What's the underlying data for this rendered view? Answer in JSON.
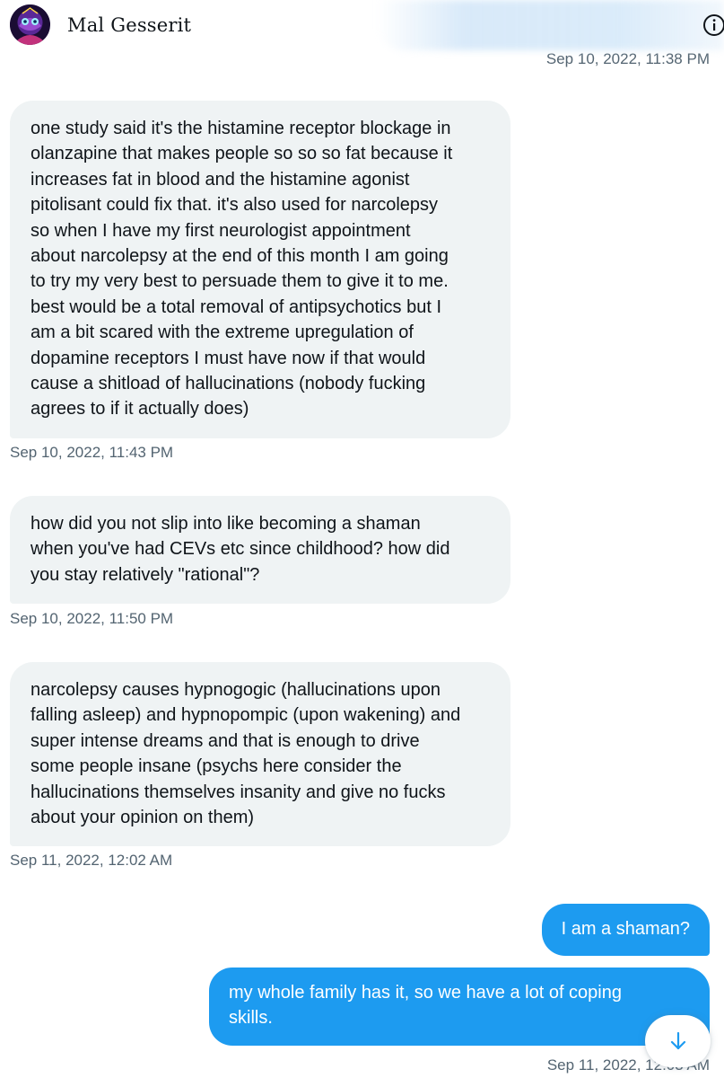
{
  "header": {
    "name": "Mal Gesserit",
    "avatar_icon": "avatar-icon",
    "info_icon": "info-icon"
  },
  "colors": {
    "incoming_bubble": "#eff3f4",
    "outgoing_bubble": "#1d9bf0",
    "timestamp": "#536471",
    "text": "#0f1419"
  },
  "conversation": {
    "clipped_timestamp": "Sep 10, 2022, 11:38 PM",
    "messages": [
      {
        "direction": "incoming",
        "lines": [
          "one study said it's the histamine receptor blockage in",
          "olanzapine that makes people so so so fat because it",
          "increases fat in blood and the histamine agonist",
          "pitolisant could fix that. it's also used for narcolepsy",
          "so when I have my first neurologist appointment",
          "about narcolepsy at the end of this month I am going",
          "to try my very best to persuade them to give it to me.",
          "best would be a total removal of antipsychotics but I",
          "am a bit scared with the extreme upregulation of",
          "dopamine receptors I must have now if that would",
          "cause a shitload of hallucinations (nobody fucking",
          "agrees to if it actually does)"
        ],
        "timestamp": "Sep 10, 2022, 11:43 PM"
      },
      {
        "direction": "incoming",
        "lines": [
          "how did you not slip into like becoming a shaman",
          "when you've had CEVs etc since childhood? how did",
          "you stay relatively \"rational\"?"
        ],
        "timestamp": "Sep 10, 2022, 11:50 PM"
      },
      {
        "direction": "incoming",
        "lines": [
          "narcolepsy causes hypnogogic (hallucinations upon",
          "falling asleep) and hypnopompic (upon wakening) and",
          "super intense dreams and that is enough to drive",
          "some people insane (psychs here consider the",
          "hallucinations themselves insanity and give no fucks",
          "about your opinion on them)"
        ],
        "timestamp": "Sep 11, 2022, 12:02 AM"
      },
      {
        "direction": "outgoing",
        "lines": [
          "I am a shaman?"
        ]
      },
      {
        "direction": "outgoing",
        "lines": [
          "my whole family has it, so we have a lot of coping",
          "skills."
        ],
        "timestamp": "Sep 11, 2022, 12:03 AM"
      }
    ]
  },
  "scroll_button": {
    "icon": "arrow-down-icon"
  }
}
